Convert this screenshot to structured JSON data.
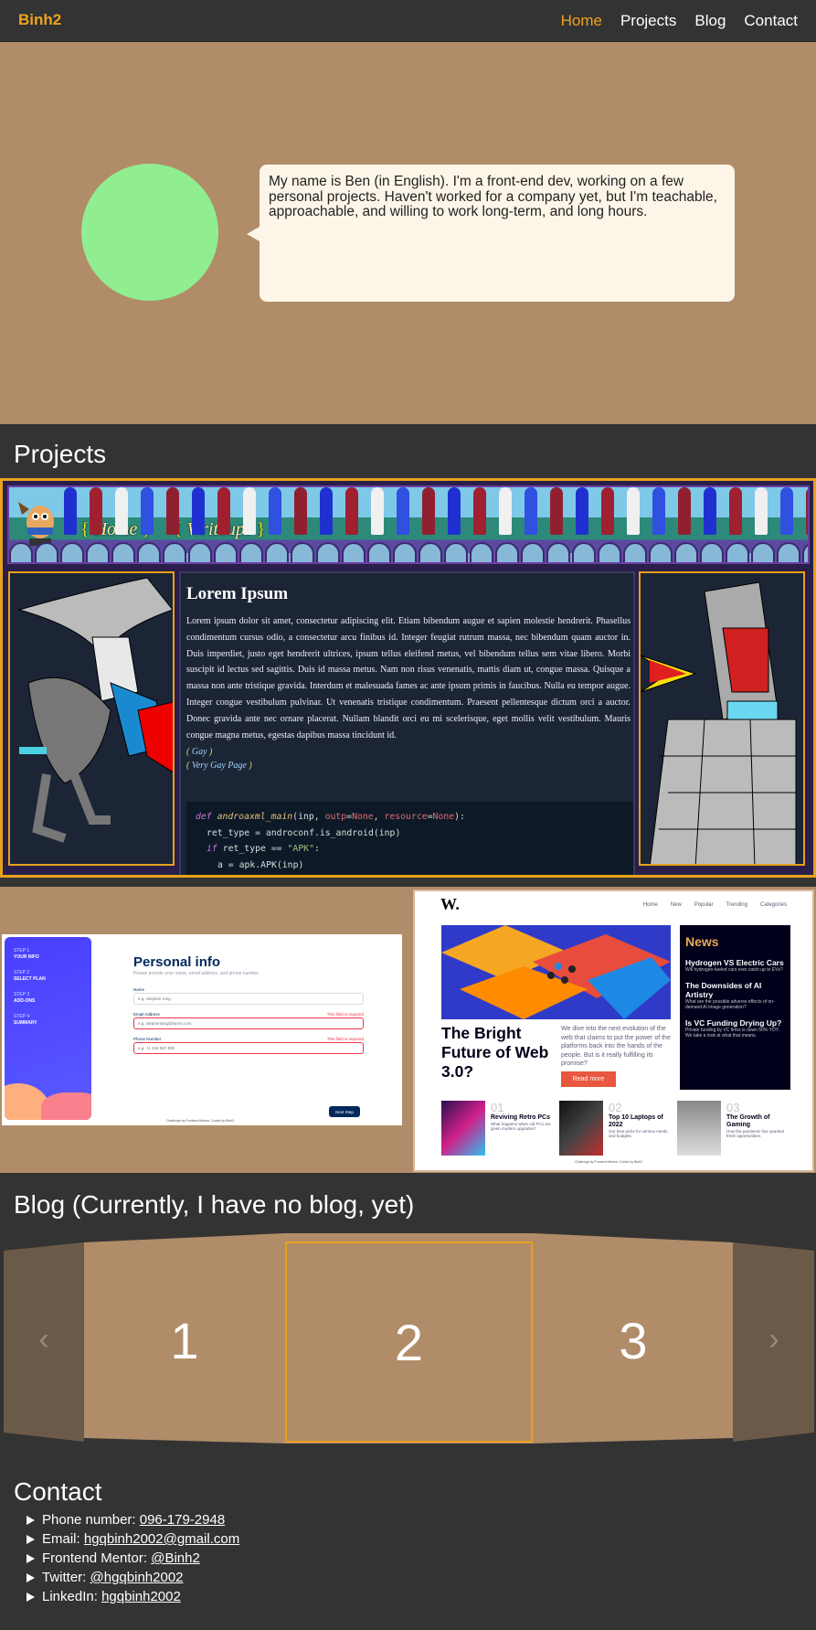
{
  "nav": {
    "brand": "Binh2",
    "links": [
      "Home",
      "Projects",
      "Blog",
      "Contact"
    ],
    "active": "Home"
  },
  "hero": {
    "bio": "My name is Ben (in English). I'm a front-end dev, working on a few personal projects. Haven't worked for a company yet, but I'm teachable, approachable, and willing to work long-term, and long hours."
  },
  "projects": {
    "title": "Projects",
    "project1": {
      "banner_links": [
        "Home",
        "Writeups"
      ],
      "article_title": "Lorem Ipsum",
      "article_body": "Lorem ipsum dolor sit amet, consectetur adipiscing elit. Etiam bibendum augue et sapien molestie hendrerit. Phasellus condimentum cursus odio, a consectetur arcu finibus id. Integer feugiat rutrum massa, nec bibendum quam auctor in. Duis imperdiet, justo eget hendrerit ultrices, ipsum tellus eleifend metus, vel bibendum tellus sem vitae libero. Morbi suscipit id lectus sed sagittis. Duis id massa metus. Nam non risus venenatis, mattis diam ut, congue massa. Quisque a massa non ante tristique gravida. Interdum et malesuada fames ac ante ipsum primis in faucibus. Nulla eu tempor augue. Integer congue vestibulum pulvinar. Ut venenatis tristique condimentum. Praesent pellentesque dictum orci a auctor. Donec gravida ante nec ornare placerat. Nullam blandit orci eu mi scelerisque, eget mollis velit vestibulum. Mauris congue magna metus, egestas dapibus massa tincidunt id.",
      "links": [
        "Gay",
        "Very Gay Page"
      ],
      "code_lines": [
        "def androaxml_main(inp, outp=None, resource=None):",
        "ret_type = androconf.is_android(inp)",
        "if ret_type == \"APK\":",
        "a = apk.APK(inp)"
      ]
    },
    "project2": {
      "steps": [
        {
          "step": "STEP 1",
          "name": "YOUR INFO"
        },
        {
          "step": "STEP 2",
          "name": "SELECT PLAN"
        },
        {
          "step": "STEP 3",
          "name": "ADD-ONS"
        },
        {
          "step": "STEP 4",
          "name": "SUMMARY"
        }
      ],
      "title": "Personal info",
      "subtitle": "Please provide your name, email address, and phone number.",
      "fields": [
        {
          "label": "Name",
          "placeholder": "e.g. Stephen King",
          "error": ""
        },
        {
          "label": "Email Address",
          "placeholder": "e.g. stephenking@lorem.com",
          "error": "This field is required"
        },
        {
          "label": "Phone Number",
          "placeholder": "e.g. +1 234 567 890",
          "error": "This field is required"
        }
      ],
      "next_button": "Next Step",
      "footer": "Challenge by Frontend Mentor. Coded by Binh2."
    },
    "project3": {
      "logo": "W.",
      "menu": [
        "Home",
        "New",
        "Popular",
        "Trending",
        "Categories"
      ],
      "headline": "The Bright Future of Web 3.0?",
      "summary": "We dive into the next evolution of the web that claims to put the power of the platforms back into the hands of the people. But is it really fulfilling its promise?",
      "read_more": "Read more",
      "news_title": "News",
      "news": [
        {
          "title": "Hydrogen VS Electric Cars",
          "text": "Will hydrogen-fueled cars ever catch up to EVs?"
        },
        {
          "title": "The Downsides of AI Artistry",
          "text": "What are the possible adverse effects of on-demand AI image generation?"
        },
        {
          "title": "Is VC Funding Drying Up?",
          "text": "Private funding by VC firms is down 50% YOY. We take a look at what that means."
        }
      ],
      "articles": [
        {
          "num": "01",
          "title": "Reviving Retro PCs",
          "text": "What happens when old PCs are given modern upgrades?"
        },
        {
          "num": "02",
          "title": "Top 10 Laptops of 2022",
          "text": "Our best picks for various needs and budgets."
        },
        {
          "num": "03",
          "title": "The Growth of Gaming",
          "text": "How the pandemic has sparked fresh opportunities."
        }
      ],
      "footer": "Challenge by Frontend Mentor. Coded by Binh2."
    }
  },
  "blog": {
    "title": "Blog (Currently, I have no blog, yet)",
    "slides": [
      "1",
      "2",
      "3"
    ],
    "prev": "‹",
    "next": "›"
  },
  "contact": {
    "title": "Contact",
    "items": [
      {
        "label": "Phone number: ",
        "value": "096-179-2948"
      },
      {
        "label": "Email: ",
        "value": "hgqbinh2002@gmail.com"
      },
      {
        "label": "Frontend Mentor: ",
        "value": "@Binh2"
      },
      {
        "label": "Twitter: ",
        "value": "@hgqbinh2002"
      },
      {
        "label": "LinkedIn: ",
        "value": "hgqbinh2002"
      }
    ]
  },
  "colors": {
    "accent": "#f0a21e",
    "hero_bg": "#b08c69",
    "page_bg": "#333333",
    "avatar": "#90ee90",
    "bubble": "#fdf6e8"
  }
}
